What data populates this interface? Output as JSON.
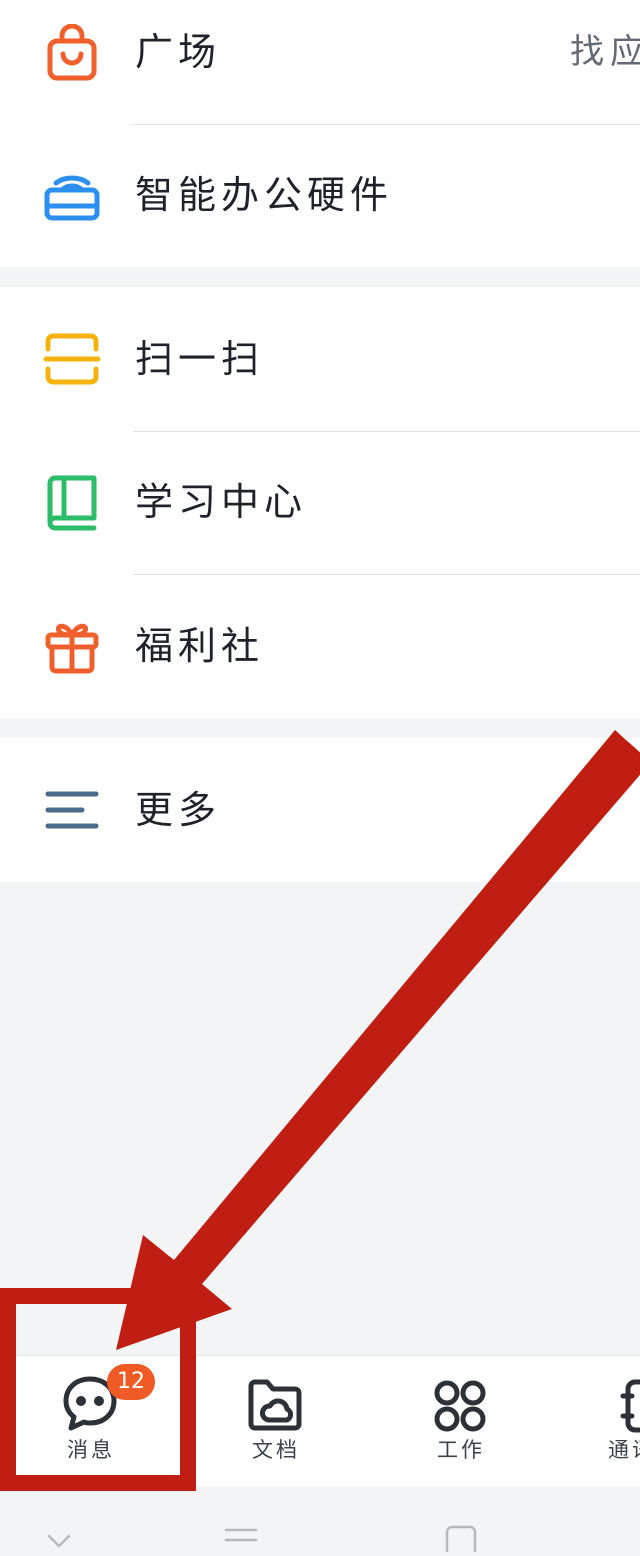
{
  "menu": {
    "guangchang_label": "广场",
    "guangchang_trail": "找应",
    "hardware_label": "智能办公硬件",
    "scan_label": "扫一扫",
    "learning_label": "学习中心",
    "welfare_label": "福利社",
    "more_label": "更多"
  },
  "tabbar": {
    "messages_label": "消息",
    "messages_badge": "12",
    "docs_label": "文档",
    "work_label": "工作",
    "contacts_label": "通讯"
  },
  "icons": {
    "guangchang": "shopping-bag-icon",
    "hardware": "router-wifi-icon",
    "scan": "scan-icon",
    "learning": "book-icon",
    "welfare": "gift-icon",
    "more": "menu-lines-icon",
    "messages": "chat-bubble-icon",
    "docs": "folder-cloud-icon",
    "work": "apps-grid-icon",
    "contacts": "contacts-icon",
    "nav_back": "chevron-down-icon",
    "nav_home": "menu-lines-icon",
    "nav_recents": "square-icon"
  },
  "colors": {
    "orange": "#f0602c",
    "blue": "#2b8ff0",
    "yellow": "#f5b20c",
    "green": "#2bbd6a",
    "slate": "#4a6a8a",
    "annotation_red": "#c01e12"
  }
}
